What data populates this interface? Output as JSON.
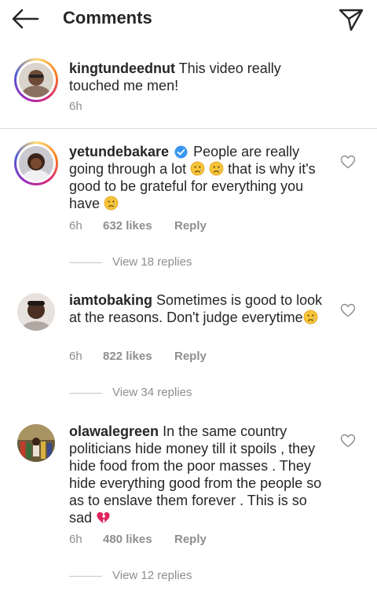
{
  "header": {
    "title": "Comments"
  },
  "colors": {
    "text": "#262626",
    "muted": "#8e8e8e",
    "verified": "#3897f0",
    "divider": "#dbdbdb"
  },
  "caption": {
    "username": "kingtundeednut",
    "text": "This video really touched me men!",
    "time": "6h"
  },
  "comments": [
    {
      "username": "yetundebakare",
      "verified": true,
      "text1": "People are really going through a lot",
      "text2": "that is why it's good to be grateful for everything you have",
      "time": "6h",
      "likes": "632 likes",
      "reply": "Reply",
      "view_replies": "View 18 replies"
    },
    {
      "username": "iamtobaking",
      "text": "Sometimes is good to look at the reasons. Don't judge everytime",
      "time": "6h",
      "likes": "822 likes",
      "reply": "Reply",
      "view_replies": "View 34 replies"
    },
    {
      "username": "olawalegreen",
      "text": "In the same country politicians hide money till it spoils , they hide food from the poor masses . They hide everything good from the people so as to enslave them forever . This is so sad",
      "time": "6h",
      "likes": "480 likes",
      "reply": "Reply",
      "view_replies": "View 12 replies"
    }
  ],
  "icons": {
    "back": "arrow-left-icon",
    "send": "paper-plane-icon",
    "like": "heart-outline-icon",
    "verified": "verified-badge-icon",
    "sad": "crying-face-emoji",
    "broken_heart": "broken-heart-emoji"
  }
}
